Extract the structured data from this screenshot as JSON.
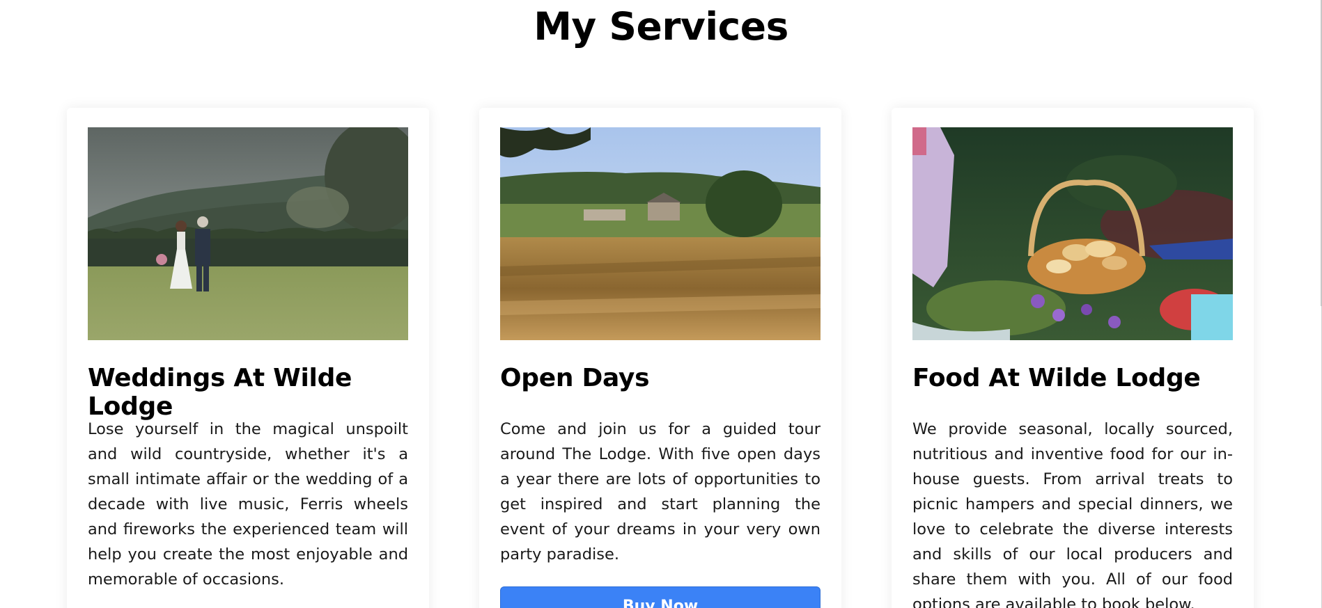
{
  "section": {
    "title": "My Services"
  },
  "cards": [
    {
      "title": "Weddings At Wilde Lodge",
      "text": "Lose yourself in the magical unspoilt and wild countryside, whether it's a small intimate affair or the wedding of a decade with live music, Ferris wheels and fireworks the experienced team will help you create the most enjoyable and memorable of occasions."
    },
    {
      "title": "Open Days",
      "text": "Come and join us for a guided tour around The Lodge. With five open days a year there are lots of opportunities to get inspired and start planning the event of your dreams in your very own party paradise.",
      "button_label": "Buy Now"
    },
    {
      "title": "Food At Wilde Lodge",
      "text": "We provide seasonal, locally sourced, nutritious and inventive food for our in-house guests. From arrival treats to picnic hampers and special dinners, we love to celebrate the diverse interests and skills of our local producers and share them with you. All of our food options are available to book below."
    }
  ],
  "colors": {
    "button": "#3b82f6",
    "heading": "#000000",
    "body_text": "#1a1a1a"
  }
}
